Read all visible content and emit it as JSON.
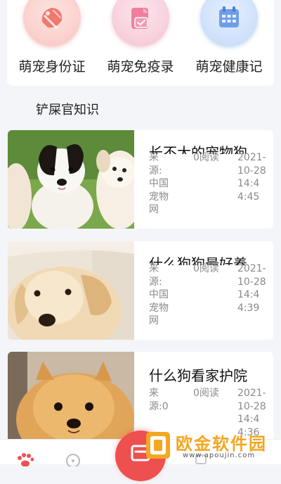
{
  "categories": [
    {
      "label": "萌宠身份证",
      "icon": "id-card-icon",
      "color": "#f07a6f"
    },
    {
      "label": "萌宠免疫录",
      "icon": "vaccine-record-icon",
      "color": "#ef7f9c"
    },
    {
      "label": "萌宠健康记",
      "icon": "health-calendar-icon",
      "color": "#6e9ee8"
    }
  ],
  "section_title": "铲屎官知识",
  "articles": [
    {
      "title": "长不大的宠物狗",
      "source": "来源:中国宠物网",
      "reads": "0阅读",
      "time": "2021-10-28 14:44:45",
      "image": "puppies-photo"
    },
    {
      "title": "什么狗狗最好养",
      "source": "来源:中国宠物网",
      "reads": "0阅读",
      "time": "2021-10-28 14:44:39",
      "image": "golden-retriever-photo"
    },
    {
      "title": "什么狗看家护院",
      "source": "来源:0",
      "reads": "0阅读",
      "time": "2021-10-28 14:44:36",
      "image": "pomeranian-photo"
    }
  ],
  "watermark": {
    "text": "欧金软件园",
    "url": "www.apoujin.com"
  },
  "colors": {
    "accent": "#ee4f4f",
    "background": "#f4f5f9",
    "watermark": "#f3a722"
  }
}
